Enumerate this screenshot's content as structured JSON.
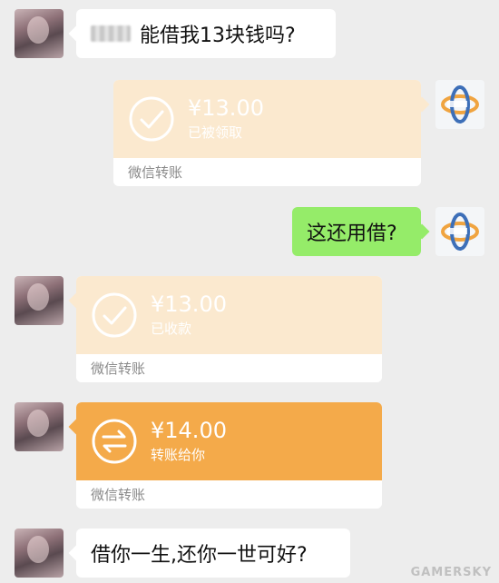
{
  "messages": [
    {
      "side": "left",
      "type": "text",
      "text": "能借我13块钱吗?"
    },
    {
      "side": "right",
      "type": "transfer",
      "amount": "¥13.00",
      "status": "已被领取",
      "footer": "微信转账"
    },
    {
      "side": "right",
      "type": "text",
      "text": "这还用借?"
    },
    {
      "side": "left",
      "type": "transfer",
      "amount": "¥13.00",
      "status": "已收款",
      "footer": "微信转账"
    },
    {
      "side": "left",
      "type": "transfer",
      "amount": "¥14.00",
      "status": "转账给你",
      "footer": "微信转账"
    },
    {
      "side": "left",
      "type": "text",
      "text": "借你一生,还你一世可好?"
    }
  ],
  "colors": {
    "background": "#ededed",
    "green_bubble": "#95ec69",
    "transfer_active": "#f4aa4a",
    "transfer_faded": "#fbe9cf"
  },
  "icons": {
    "received": "check-circle-icon",
    "pending": "transfer-arrows-icon"
  },
  "watermark": "GAMERSKY"
}
